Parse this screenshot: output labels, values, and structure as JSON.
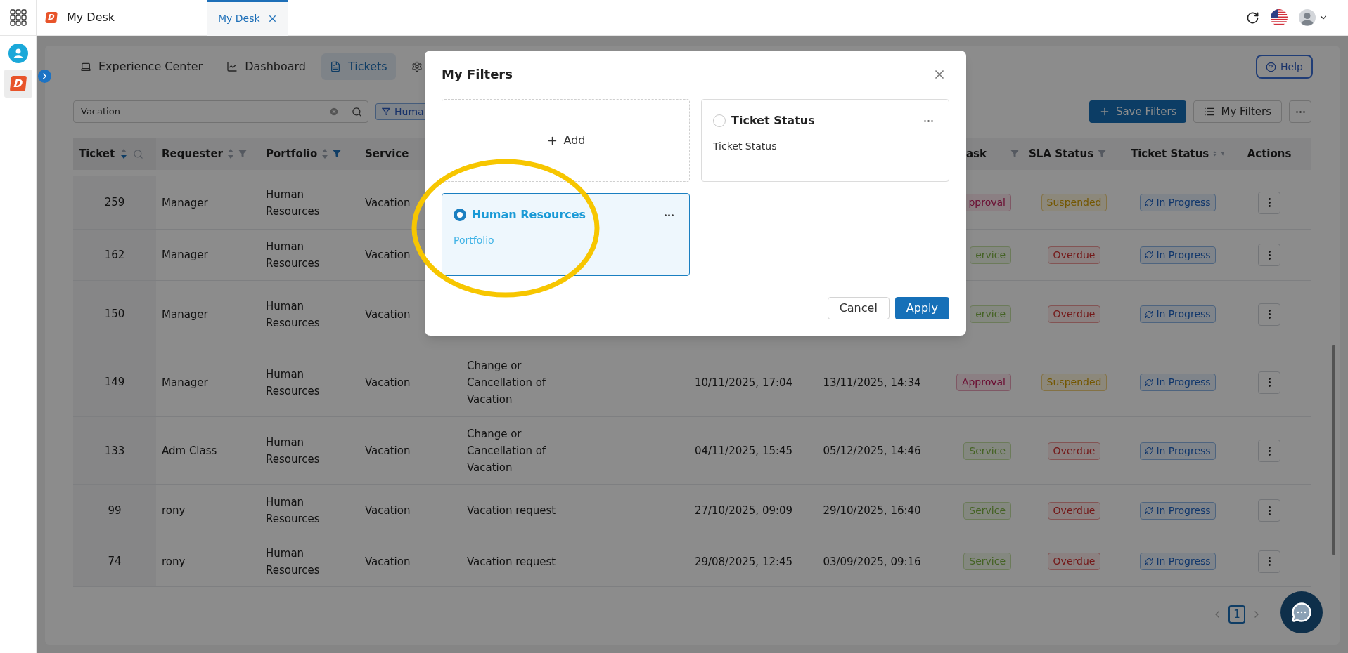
{
  "top_bar": {
    "logo": "D",
    "title": "My Desk",
    "tabs": [
      {
        "label": "My Desk",
        "selected": true
      }
    ]
  },
  "rail": {
    "logo": "D"
  },
  "nav_tabs": [
    {
      "label": "Experience Center",
      "selected": false
    },
    {
      "label": "Dashboard",
      "selected": false
    },
    {
      "label": "Tickets",
      "selected": true
    },
    {
      "selected": false
    }
  ],
  "help_button": "Help",
  "search": {
    "value": "Vacation"
  },
  "filter_chip": "Huma",
  "toolbar_buttons": [
    "Save Filters",
    "My Filters"
  ],
  "table": {
    "header": {
      "ticket": {
        "label": "Ticket",
        "sort_active": true,
        "search": true
      },
      "requester": {
        "label": "Requester",
        "sort_active": false,
        "filter_active": false
      },
      "portfolio": {
        "label": "Portfolio",
        "sort_active": false,
        "filter_active": true
      },
      "service": {
        "label": "Service"
      },
      "column_8": {
        "label": "ask",
        "filter_active": false
      },
      "sla_status": {
        "label": "SLA Status",
        "filter_active": false
      },
      "ticket_status": {
        "label": "Ticket Status",
        "sort_active": false,
        "filter_active": false
      },
      "actions": {
        "label": "Actions"
      }
    },
    "rows": [
      {
        "ticket": "259",
        "requester": "Manager",
        "portfolio": "Human Resources",
        "service": "Vacation",
        "column_8": {
          "text": "pproval",
          "kind": "approval"
        },
        "sla_status": {
          "text": "Suspended",
          "kind": "suspended"
        },
        "ticket_status": "In Progress"
      },
      {
        "ticket": "162",
        "requester": "Manager",
        "portfolio": "Human Resources",
        "service": "Vacation",
        "column_8": {
          "text": "ervice",
          "kind": "service"
        },
        "sla_status": {
          "text": "Overdue",
          "kind": "overdue"
        },
        "ticket_status": "In Progress"
      },
      {
        "ticket": "150",
        "requester": "Manager",
        "portfolio": "Human Resources",
        "service": "Vacation",
        "column_8": {
          "text": "ervice",
          "kind": "service"
        },
        "sla_status": {
          "text": "Overdue",
          "kind": "overdue"
        },
        "ticket_status": "In Progress"
      },
      {
        "ticket": "149",
        "requester": "Manager",
        "portfolio": "Human Resources",
        "service": "Vacation",
        "column_5": "Change or Cancellation of Vacation",
        "column_6": "10/11/2025, 17:04",
        "column_7": "13/11/2025, 14:34",
        "column_8": {
          "text": "Approval",
          "kind": "approval"
        },
        "sla_status": {
          "text": "Suspended",
          "kind": "suspended"
        },
        "ticket_status": "In Progress"
      },
      {
        "ticket": "133",
        "requester": "Adm Class",
        "portfolio": "Human Resources",
        "service": "Vacation",
        "column_5": "Change or Cancellation of Vacation",
        "column_6": "04/11/2025, 15:45",
        "column_7": "05/12/2025, 14:46",
        "column_8": {
          "text": "Service",
          "kind": "service"
        },
        "sla_status": {
          "text": "Overdue",
          "kind": "overdue"
        },
        "ticket_status": "In Progress"
      },
      {
        "ticket": "99",
        "requester": "rony",
        "portfolio": "Human Resources",
        "service": "Vacation",
        "column_5": "Vacation request",
        "column_6": "27/10/2025, 09:09",
        "column_7": "29/10/2025, 16:40",
        "column_8": {
          "text": "Service",
          "kind": "service"
        },
        "sla_status": {
          "text": "Overdue",
          "kind": "overdue"
        },
        "ticket_status": "In Progress"
      },
      {
        "ticket": "74",
        "requester": "rony",
        "portfolio": "Human Resources",
        "service": "Vacation",
        "column_5": "Vacation request",
        "column_6": "29/08/2025, 12:45",
        "column_7": "03/09/2025, 09:16",
        "column_8": {
          "text": "Service",
          "kind": "service"
        },
        "sla_status": {
          "text": "Overdue",
          "kind": "overdue"
        },
        "ticket_status": "In Progress"
      }
    ]
  },
  "pagination": {
    "pages": [
      {
        "label": "1",
        "selected": true
      }
    ]
  },
  "modal": {
    "title": "My Filters",
    "add_label": "Add",
    "filters": [
      {
        "name": "Ticket Status",
        "description": "Ticket Status",
        "selected": false
      },
      {
        "name": "Human Resources",
        "description": "Portfolio",
        "selected": true
      }
    ],
    "buttons": [
      "Cancel",
      "Apply"
    ]
  }
}
